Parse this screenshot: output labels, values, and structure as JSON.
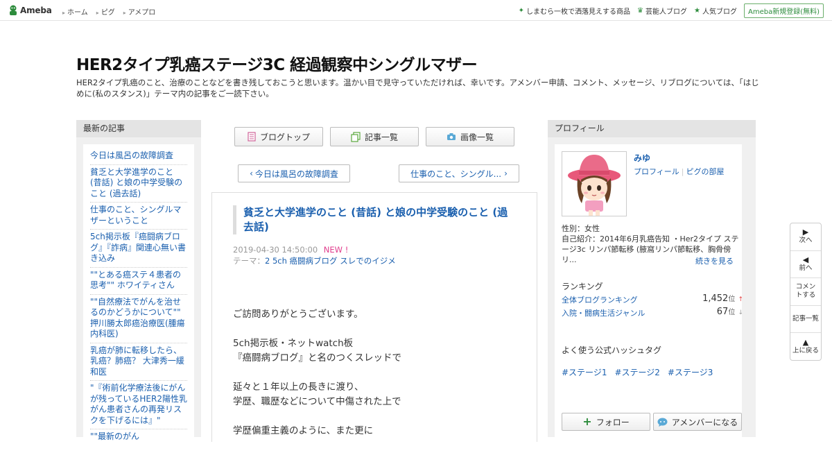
{
  "global_header": {
    "logo_text": "Ameba",
    "nav": [
      "ホーム",
      "ピグ",
      "アメプロ"
    ],
    "right_links": [
      "しまむら一枚で洒落見えする商品",
      "芸能人ブログ",
      "人気ブログ"
    ],
    "register": "Ameba新規登録(無料)"
  },
  "blog": {
    "title": "HER2タイプ乳癌ステージ3C 経過観察中シングルマザー",
    "description": "HER2タイプ乳癌のこと、治療のことなどを書き残しておこうと思います。温かい目で見守っていただければ、幸いです。アメンバー申請、コメント、メッセージ、リブログについては、「はじめに(私のスタンス)」テーマ内の記事をご一読下さい。"
  },
  "recent": {
    "header": "最新の記事",
    "items": [
      "今日は風呂の故障調査",
      "貧乏と大学進学のこと (昔話) と娘の中学受験のこと (過去話)",
      "仕事のこと、シングルマザーということ",
      "5ch掲示板『癌闘病ブログ』『詐病』関連心無い書き込み",
      "\"\"とある癌ステ４患者の思考\"\" ホワイティさん",
      "\"\"自然療法でがんを治せるのかどうかについて\"\" 押川勝太郎癌治療医(腫瘍内科医)",
      "乳癌が肺に転移したら、乳癌？肺癌？ 大津秀一緩和医",
      "\"『術前化学療法後にがんが残っているHER2陽性乳がん患者さんの再発リスクを下げるには』\"",
      "\"\"最新のがん"
    ]
  },
  "tabs": {
    "top": "ブログトップ",
    "list": "記事一覧",
    "images": "画像一覧"
  },
  "pager": {
    "prev": "今日は風呂の故障調査",
    "next": "仕事のこと、シングル..."
  },
  "entry": {
    "title": "貧乏と大学進学のこと (昔話) と娘の中学受験のこと (過去話)",
    "date": "2019-04-30 14:50:00",
    "new_badge": "NEW !",
    "theme_label": "テーマ：",
    "theme": "2 5ch 癌闘病ブログ スレでのイジメ",
    "body": [
      "ご訪問ありがとうございます。",
      "5ch掲示板・ネットwatch板\n『癌闘病ブログ』と名のつくスレッドで",
      "延々と１年以上の長きに渡り、\n学歴、職歴などについて中傷された上で",
      "学歴偏重主義のように、また更に"
    ]
  },
  "profile": {
    "header": "プロフィール",
    "name": "みゆ",
    "link_profile": "プロフィール",
    "link_pig": "ピグの部屋",
    "gender": "性別：女性",
    "intro": "自己紹介：2014年6月乳癌告知 ・Her2タイプ ステージ3c リンパ節転移 (腋窩リンパ節転移、胸骨傍リ...",
    "more": "続きを見る",
    "ranking_header": "ランキング",
    "rankings": [
      {
        "label": "全体ブログランキング",
        "value": "1,452",
        "unit": "位",
        "trend": "↑"
      },
      {
        "label": "入院・闘病生活ジャンル",
        "value": "67",
        "unit": "位",
        "trend": "↓"
      }
    ],
    "hashtag_header": "よく使う公式ハッシュタグ",
    "hashtags": [
      "#ステージ1",
      "#ステージ2",
      "#ステージ3"
    ],
    "follow": "フォロー",
    "member": "アメンバーになる"
  },
  "float_nav": {
    "next": "次へ",
    "prev": "前へ",
    "comment": "コメントする",
    "list": "記事一覧",
    "top": "上に戻る"
  },
  "colors": {
    "link": "#1a5fae",
    "accent_green": "#2d8c3c",
    "new_pink": "#e03d8d"
  }
}
